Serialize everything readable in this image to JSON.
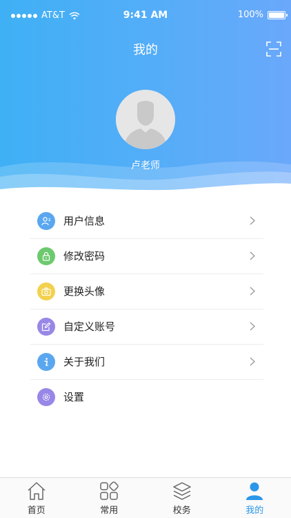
{
  "status_bar": {
    "carrier": "AT&T",
    "time": "9:41 AM",
    "battery": "100%"
  },
  "header": {
    "title": "我的"
  },
  "profile": {
    "name": "卢老师"
  },
  "menu": {
    "items": [
      {
        "label": "用户信息",
        "icon": "user-info-icon",
        "color": "#5aa7f0"
      },
      {
        "label": "修改密码",
        "icon": "lock-icon",
        "color": "#6dc96e"
      },
      {
        "label": "更换头像",
        "icon": "camera-icon",
        "color": "#f2d14f"
      },
      {
        "label": "自定义账号",
        "icon": "edit-icon",
        "color": "#9887e6"
      },
      {
        "label": "关于我们",
        "icon": "info-icon",
        "color": "#5aa7f0"
      },
      {
        "label": "设置",
        "icon": "gear-icon",
        "color": "#9887e6"
      }
    ]
  },
  "tabs": [
    {
      "label": "首页",
      "icon": "home-icon"
    },
    {
      "label": "常用",
      "icon": "grid-icon"
    },
    {
      "label": "校务",
      "icon": "layers-icon"
    },
    {
      "label": "我的",
      "icon": "person-icon",
      "active": true
    }
  ],
  "colors": {
    "accent": "#2c97e8",
    "header_start": "#3fb0f5",
    "header_end": "#6aa8fb"
  }
}
